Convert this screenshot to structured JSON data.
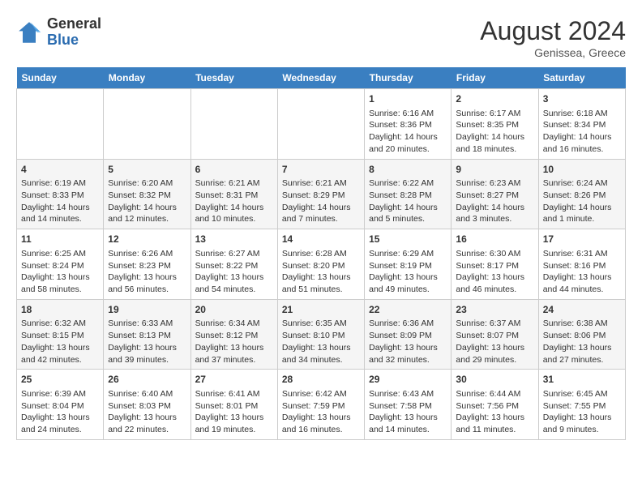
{
  "header": {
    "logo_general": "General",
    "logo_blue": "Blue",
    "month_year": "August 2024",
    "location": "Genissea, Greece"
  },
  "days_of_week": [
    "Sunday",
    "Monday",
    "Tuesday",
    "Wednesday",
    "Thursday",
    "Friday",
    "Saturday"
  ],
  "weeks": [
    [
      {
        "day": "",
        "info": ""
      },
      {
        "day": "",
        "info": ""
      },
      {
        "day": "",
        "info": ""
      },
      {
        "day": "",
        "info": ""
      },
      {
        "day": "1",
        "info": "Sunrise: 6:16 AM\nSunset: 8:36 PM\nDaylight: 14 hours\nand 20 minutes."
      },
      {
        "day": "2",
        "info": "Sunrise: 6:17 AM\nSunset: 8:35 PM\nDaylight: 14 hours\nand 18 minutes."
      },
      {
        "day": "3",
        "info": "Sunrise: 6:18 AM\nSunset: 8:34 PM\nDaylight: 14 hours\nand 16 minutes."
      }
    ],
    [
      {
        "day": "4",
        "info": "Sunrise: 6:19 AM\nSunset: 8:33 PM\nDaylight: 14 hours\nand 14 minutes."
      },
      {
        "day": "5",
        "info": "Sunrise: 6:20 AM\nSunset: 8:32 PM\nDaylight: 14 hours\nand 12 minutes."
      },
      {
        "day": "6",
        "info": "Sunrise: 6:21 AM\nSunset: 8:31 PM\nDaylight: 14 hours\nand 10 minutes."
      },
      {
        "day": "7",
        "info": "Sunrise: 6:21 AM\nSunset: 8:29 PM\nDaylight: 14 hours\nand 7 minutes."
      },
      {
        "day": "8",
        "info": "Sunrise: 6:22 AM\nSunset: 8:28 PM\nDaylight: 14 hours\nand 5 minutes."
      },
      {
        "day": "9",
        "info": "Sunrise: 6:23 AM\nSunset: 8:27 PM\nDaylight: 14 hours\nand 3 minutes."
      },
      {
        "day": "10",
        "info": "Sunrise: 6:24 AM\nSunset: 8:26 PM\nDaylight: 14 hours\nand 1 minute."
      }
    ],
    [
      {
        "day": "11",
        "info": "Sunrise: 6:25 AM\nSunset: 8:24 PM\nDaylight: 13 hours\nand 58 minutes."
      },
      {
        "day": "12",
        "info": "Sunrise: 6:26 AM\nSunset: 8:23 PM\nDaylight: 13 hours\nand 56 minutes."
      },
      {
        "day": "13",
        "info": "Sunrise: 6:27 AM\nSunset: 8:22 PM\nDaylight: 13 hours\nand 54 minutes."
      },
      {
        "day": "14",
        "info": "Sunrise: 6:28 AM\nSunset: 8:20 PM\nDaylight: 13 hours\nand 51 minutes."
      },
      {
        "day": "15",
        "info": "Sunrise: 6:29 AM\nSunset: 8:19 PM\nDaylight: 13 hours\nand 49 minutes."
      },
      {
        "day": "16",
        "info": "Sunrise: 6:30 AM\nSunset: 8:17 PM\nDaylight: 13 hours\nand 46 minutes."
      },
      {
        "day": "17",
        "info": "Sunrise: 6:31 AM\nSunset: 8:16 PM\nDaylight: 13 hours\nand 44 minutes."
      }
    ],
    [
      {
        "day": "18",
        "info": "Sunrise: 6:32 AM\nSunset: 8:15 PM\nDaylight: 13 hours\nand 42 minutes."
      },
      {
        "day": "19",
        "info": "Sunrise: 6:33 AM\nSunset: 8:13 PM\nDaylight: 13 hours\nand 39 minutes."
      },
      {
        "day": "20",
        "info": "Sunrise: 6:34 AM\nSunset: 8:12 PM\nDaylight: 13 hours\nand 37 minutes."
      },
      {
        "day": "21",
        "info": "Sunrise: 6:35 AM\nSunset: 8:10 PM\nDaylight: 13 hours\nand 34 minutes."
      },
      {
        "day": "22",
        "info": "Sunrise: 6:36 AM\nSunset: 8:09 PM\nDaylight: 13 hours\nand 32 minutes."
      },
      {
        "day": "23",
        "info": "Sunrise: 6:37 AM\nSunset: 8:07 PM\nDaylight: 13 hours\nand 29 minutes."
      },
      {
        "day": "24",
        "info": "Sunrise: 6:38 AM\nSunset: 8:06 PM\nDaylight: 13 hours\nand 27 minutes."
      }
    ],
    [
      {
        "day": "25",
        "info": "Sunrise: 6:39 AM\nSunset: 8:04 PM\nDaylight: 13 hours\nand 24 minutes."
      },
      {
        "day": "26",
        "info": "Sunrise: 6:40 AM\nSunset: 8:03 PM\nDaylight: 13 hours\nand 22 minutes."
      },
      {
        "day": "27",
        "info": "Sunrise: 6:41 AM\nSunset: 8:01 PM\nDaylight: 13 hours\nand 19 minutes."
      },
      {
        "day": "28",
        "info": "Sunrise: 6:42 AM\nSunset: 7:59 PM\nDaylight: 13 hours\nand 16 minutes."
      },
      {
        "day": "29",
        "info": "Sunrise: 6:43 AM\nSunset: 7:58 PM\nDaylight: 13 hours\nand 14 minutes."
      },
      {
        "day": "30",
        "info": "Sunrise: 6:44 AM\nSunset: 7:56 PM\nDaylight: 13 hours\nand 11 minutes."
      },
      {
        "day": "31",
        "info": "Sunrise: 6:45 AM\nSunset: 7:55 PM\nDaylight: 13 hours\nand 9 minutes."
      }
    ]
  ]
}
